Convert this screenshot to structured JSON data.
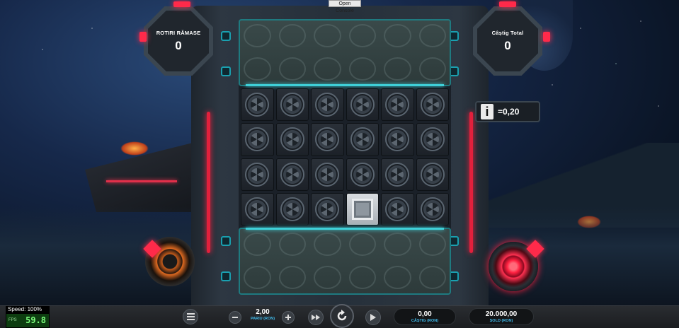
{
  "console": {
    "label": "Open Console"
  },
  "counters": {
    "spins_left": {
      "label": "ROTIRI RĂMASE",
      "value": "0"
    },
    "total_win": {
      "label": "Câștig Total",
      "value": "0"
    }
  },
  "multiplier": {
    "icon": "info-i",
    "value": "=0,20"
  },
  "grid": {
    "rows": 4,
    "cols": 6,
    "special_cell": {
      "row": 4,
      "col": 4,
      "type": "silver-crate"
    }
  },
  "perf": {
    "speed": "Speed: 100%",
    "fps_label": "FPS",
    "fps_value": "59.8"
  },
  "bottombar": {
    "bet": {
      "value": "2,00",
      "label": "PARIU (RON)"
    },
    "win": {
      "value": "0,00",
      "label": "CÂȘTIG (RON)"
    },
    "balance": {
      "value": "20.000,00",
      "label": "SOLD (RON)"
    }
  },
  "colors": {
    "accent_red": "#ff2a4a",
    "accent_teal": "#3fd0d8",
    "label_blue": "#40b8e8"
  }
}
